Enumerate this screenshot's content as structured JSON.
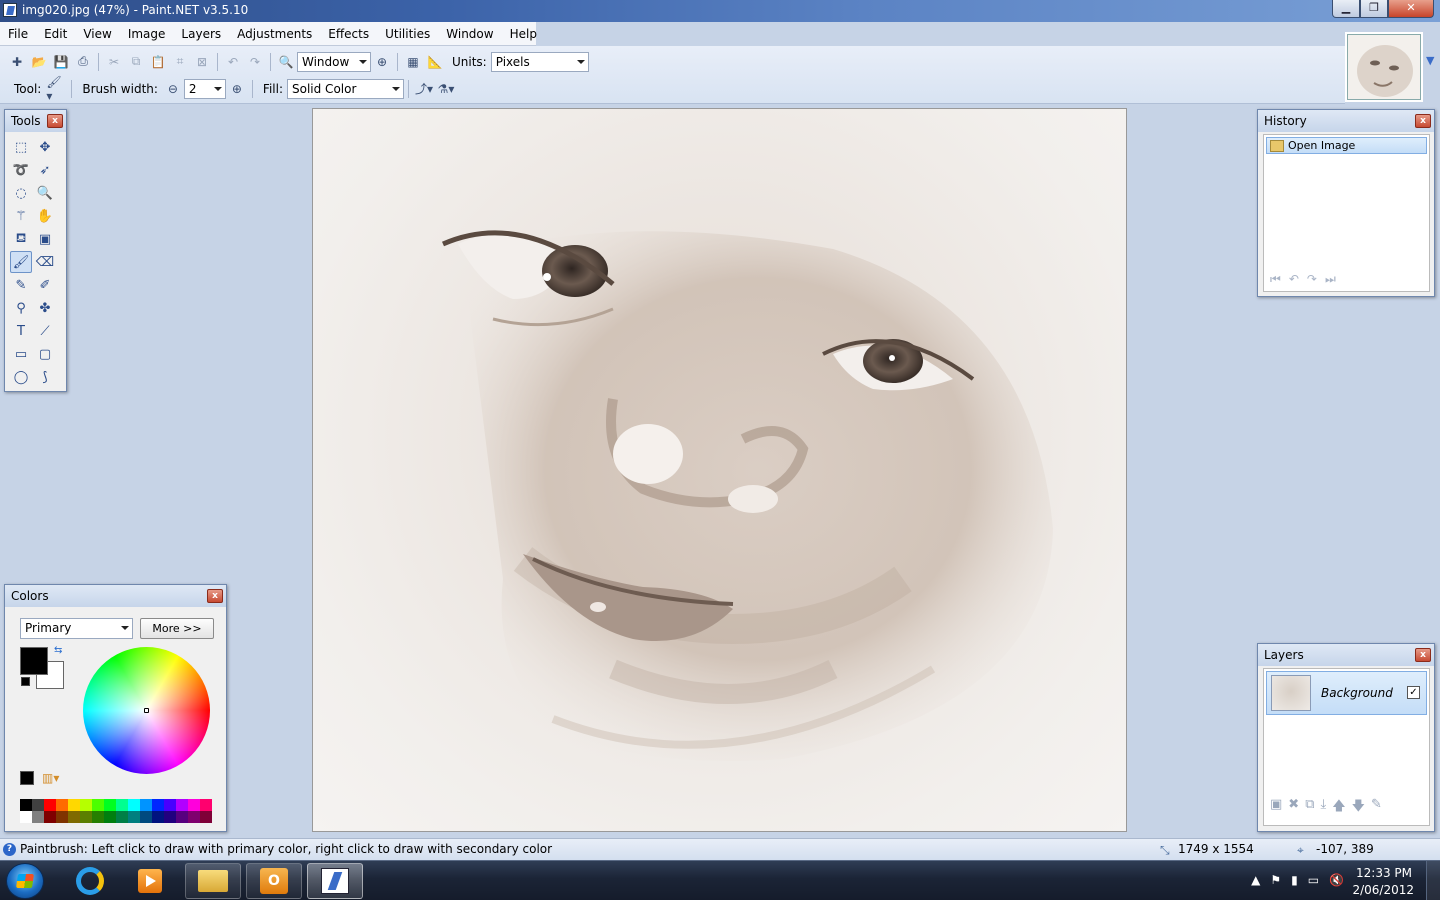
{
  "window": {
    "title": "img020.jpg (47%) - Paint.NET v3.5.10",
    "controls": {
      "minimize": "▁",
      "maximize": "❐",
      "close": "✕"
    }
  },
  "menu": [
    "File",
    "Edit",
    "View",
    "Image",
    "Layers",
    "Adjustments",
    "Effects",
    "Utilities",
    "Window",
    "Help"
  ],
  "toolbar": {
    "zoom_value": "Window",
    "units_label": "Units:",
    "units_value": "Pixels",
    "tool_label": "Tool:",
    "brush_width_label": "Brush width:",
    "brush_width_value": "2",
    "fill_label": "Fill:",
    "fill_value": "Solid Color"
  },
  "tools_window": {
    "title": "Tools",
    "active_tool": "paintbrush",
    "tools": [
      {
        "name": "rectangle-select-icon",
        "glyph": "⬚"
      },
      {
        "name": "move-selected-pixels-icon",
        "glyph": "✥"
      },
      {
        "name": "lasso-select-icon",
        "glyph": "➰"
      },
      {
        "name": "move-selection-icon",
        "glyph": "➶"
      },
      {
        "name": "ellipse-select-icon",
        "glyph": "◌"
      },
      {
        "name": "zoom-icon",
        "glyph": "🔍"
      },
      {
        "name": "magic-wand-icon",
        "glyph": "⚚"
      },
      {
        "name": "pan-icon",
        "glyph": "✋"
      },
      {
        "name": "paint-bucket-icon",
        "glyph": "⛾"
      },
      {
        "name": "gradient-icon",
        "glyph": "▣"
      },
      {
        "name": "paintbrush-icon",
        "glyph": "🖌"
      },
      {
        "name": "eraser-icon",
        "glyph": "⌫"
      },
      {
        "name": "pencil-icon",
        "glyph": "✎"
      },
      {
        "name": "color-picker-icon",
        "glyph": "✐"
      },
      {
        "name": "clone-stamp-icon",
        "glyph": "⚲"
      },
      {
        "name": "recolor-icon",
        "glyph": "✤"
      },
      {
        "name": "text-icon",
        "glyph": "T"
      },
      {
        "name": "line-curve-icon",
        "glyph": "⟋"
      },
      {
        "name": "rectangle-icon",
        "glyph": "▭"
      },
      {
        "name": "rounded-rectangle-icon",
        "glyph": "▢"
      },
      {
        "name": "ellipse-icon",
        "glyph": "◯"
      },
      {
        "name": "freeform-shape-icon",
        "glyph": "⟆"
      }
    ]
  },
  "history_window": {
    "title": "History",
    "items": [
      "Open Image"
    ]
  },
  "layers_window": {
    "title": "Layers",
    "layers": [
      {
        "name": "Background",
        "visible": true
      }
    ]
  },
  "colors_window": {
    "title": "Colors",
    "mode": "Primary",
    "more_button": "More >>",
    "primary_color": "#000000",
    "secondary_color": "#ffffff",
    "palette_top": [
      "#000000",
      "#404040",
      "#ff0000",
      "#ff6a00",
      "#ffd800",
      "#b6ff00",
      "#4cff00",
      "#00ff21",
      "#00ff90",
      "#00ffff",
      "#0094ff",
      "#0026ff",
      "#4800ff",
      "#b200ff",
      "#ff00dc",
      "#ff006e"
    ],
    "palette_bottom": [
      "#ffffff",
      "#808080",
      "#7f0000",
      "#7f3300",
      "#7f6a00",
      "#5b7f00",
      "#267f00",
      "#007f0e",
      "#007f46",
      "#007f7f",
      "#004a7f",
      "#00137f",
      "#21007f",
      "#57007f",
      "#7f006e",
      "#7f0037"
    ]
  },
  "canvas": {
    "image_name": "img020.jpg",
    "zoom": "47%"
  },
  "statusbar": {
    "help_text": "Paintbrush: Left click to draw with primary color, right click to draw with secondary color",
    "image_size": "1749 x 1554",
    "cursor_position": "-107, 389"
  },
  "taskbar": {
    "apps": [
      {
        "name": "internet-explorer",
        "state": "pinned"
      },
      {
        "name": "windows-media-player",
        "state": "pinned"
      },
      {
        "name": "windows-explorer",
        "state": "open"
      },
      {
        "name": "outlook",
        "state": "open"
      },
      {
        "name": "paint-net",
        "state": "active"
      }
    ],
    "clock_time": "12:33 PM",
    "clock_date": "2/06/2012"
  }
}
